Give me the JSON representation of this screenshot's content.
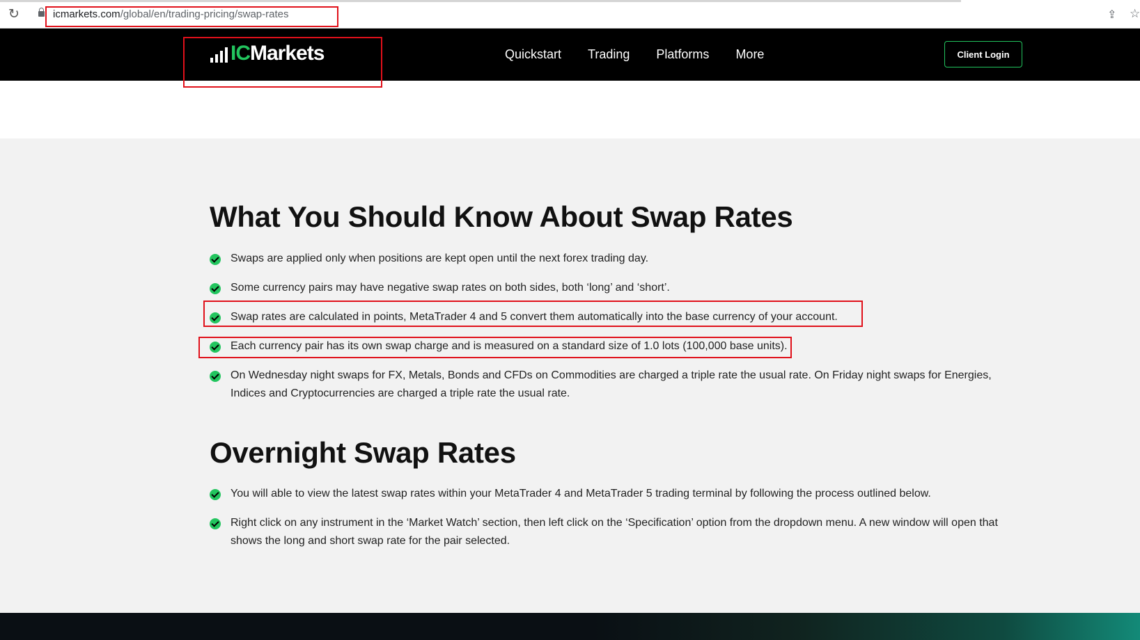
{
  "browser": {
    "url_domain": "icmarkets.com",
    "url_path": "/global/en/trading-pricing/swap-rates",
    "reload_icon": "reload-icon",
    "lock_icon": "lock-icon",
    "share_icon": "share-icon",
    "star_icon": "star-icon"
  },
  "header": {
    "logo_ic": "IC",
    "logo_markets": "Markets",
    "brand_color": "#22c55e",
    "nav": [
      {
        "label": "Quickstart"
      },
      {
        "label": "Trading"
      },
      {
        "label": "Platforms"
      },
      {
        "label": "More"
      }
    ],
    "login_label": "Client Login"
  },
  "section1": {
    "title": "What You Should Know About Swap Rates",
    "items": [
      "Swaps are applied only when positions are kept open until the next forex trading day.",
      "Some currency pairs may have negative swap rates on both sides, both ‘long’ and ‘short’.",
      "Swap rates are calculated in points, MetaTrader 4 and 5 convert them automatically into the base currency of your account.",
      "Each currency pair has its own swap charge and is measured on a standard size of 1.0 lots (100,000 base units).",
      "On Wednesday night swaps for FX, Metals, Bonds and CFDs on Commodities are charged a triple rate the usual rate. On Friday night swaps for Energies, Indices and Cryptocurrencies are charged a triple rate the usual rate."
    ]
  },
  "section2": {
    "title": "Overnight Swap Rates",
    "items": [
      "You will able to view the latest swap rates within your MetaTrader 4 and MetaTrader 5 trading terminal by following the process outlined below.",
      "Right click on any instrument in the ‘Market Watch’ section, then left click on the ‘Specification’ option from the dropdown menu. A new window will open that shows the long and short swap rate for the pair selected."
    ]
  },
  "annotation_color": "#e0101a"
}
